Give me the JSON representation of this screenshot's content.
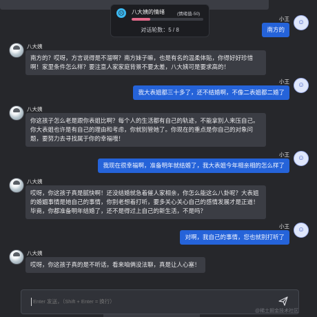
{
  "mood": {
    "name": "八大姨的情绪",
    "score_text": "(情绪值-50)",
    "level_fraction": 0.26,
    "rounds_label": "对话轮数",
    "rounds_value": "5 / 8"
  },
  "messages": [
    {
      "role": "user",
      "name": "小王",
      "text": "南方的"
    },
    {
      "role": "aunt",
      "name": "八大姨",
      "text": "南方的？哎呀，方言说得是不溜啊？南方妹子嘛，也是有名的温柔体贴，你得好好珍惜啊！家里条件怎么样？要注意人家家庭背景不要太差，八大姨可是要求高的！"
    },
    {
      "role": "user",
      "name": "小王",
      "text": "我大表姐都三十多了，还不结婚啊，不像二表姐都二婚了"
    },
    {
      "role": "aunt",
      "name": "八大姨",
      "text": "你这孩子怎么老是跟你表姐比啊？每个人的生活都有自己的轨迹，不能拿别人来压自己。你大表姐也许是有自己的理由和考虑，你就别管她了。你现在的重点是你自己的对象问题，要努力去寻找属于你的幸福哦！"
    },
    {
      "role": "user",
      "name": "小王",
      "text": "我现在很幸福啊，准备明年就结婚了，我大表姐今年相亲相的怎么样了"
    },
    {
      "role": "aunt",
      "name": "八大姨",
      "text": "哎呀，你这孩子真是腻快啊！还没结婚就急着催人家相亲，你怎么能这么八卦呢？大表姐的婚姻事情是她自己的事情，你别老想着打听，要多关心关心自己的感情发展才是正道！毕竟，你都准备明年结婚了，还不是得过上自己的新生活，不是吗？"
    },
    {
      "role": "user",
      "name": "小王",
      "text": "对啊，我自己的事情，您也就别打听了"
    },
    {
      "role": "aunt",
      "name": "八大姨",
      "text": "哎呀，你这孩子真的是不听话，看来咱俩没法聊，真是让人心塞！"
    }
  ],
  "input": {
    "placeholder": "Enter 发送，（Shift + Enter = 换行）"
  },
  "watermark": "@稀土掘金技术社区",
  "icons": {
    "mood": "anxious-face-icon",
    "send": "send-icon",
    "user_avatar": "robot-avatar-icon",
    "aunt_avatar": "aunt-avatar-icon"
  }
}
